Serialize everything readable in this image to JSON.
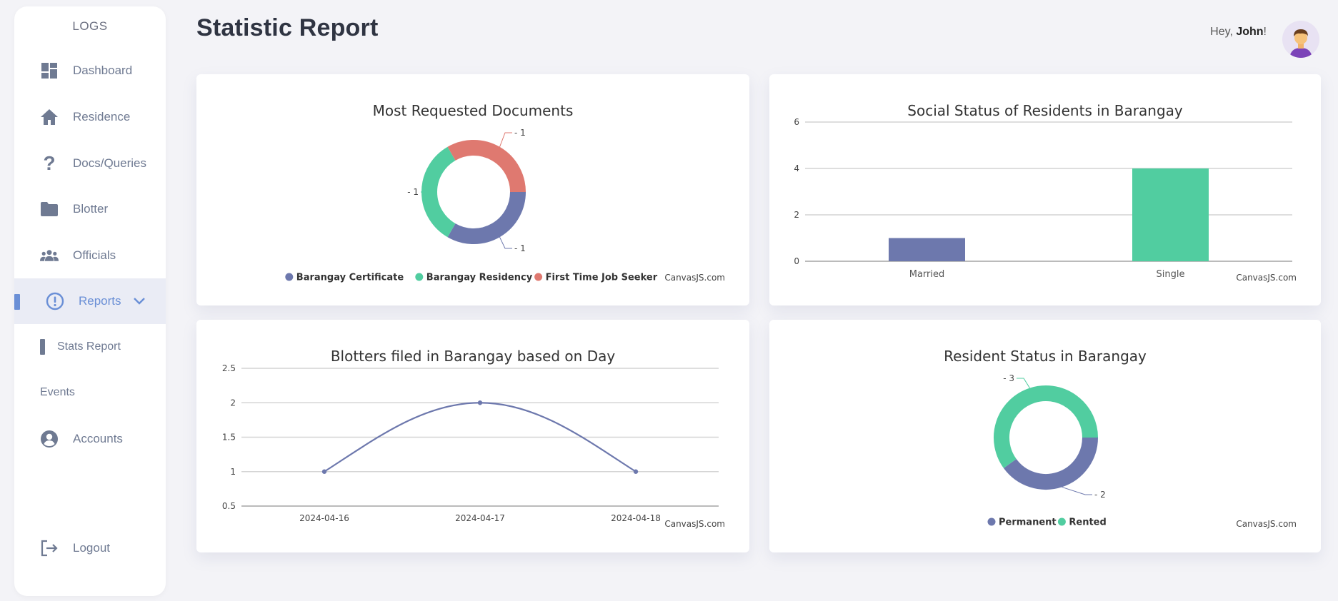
{
  "sidebar": {
    "logo": "LOGS",
    "items": [
      {
        "label": "Dashboard"
      },
      {
        "label": "Residence"
      },
      {
        "label": "Docs/Queries"
      },
      {
        "label": "Blotter"
      },
      {
        "label": "Officials"
      },
      {
        "label": "Reports"
      },
      {
        "label": "Stats Report"
      },
      {
        "label": "Events"
      },
      {
        "label": "Accounts"
      },
      {
        "label": "Logout"
      }
    ],
    "active_color": "#6a8fd6"
  },
  "header": {
    "title": "Statistic Report",
    "greeting_prefix": "Hey, ",
    "user_name": "John",
    "greeting_suffix": "!"
  },
  "colors": {
    "blue": "#6d78ad",
    "green": "#51cda0",
    "red": "#df7970"
  },
  "chart_data": [
    {
      "type": "pie",
      "title": "Most Requested Documents",
      "credit": "CanvasJS.com",
      "slices": [
        {
          "label": "Barangay Certificate",
          "value": 1,
          "color": "#6d78ad"
        },
        {
          "label": "Barangay Residency",
          "value": 1,
          "color": "#51cda0"
        },
        {
          "label": "First Time Job Seeker",
          "value": 1,
          "color": "#df7970"
        }
      ],
      "legend": "bottom"
    },
    {
      "type": "bar",
      "title": "Social Status of Residents in Barangay",
      "credit": "CanvasJS.com",
      "categories": [
        "Married",
        "Single"
      ],
      "values": [
        1,
        4
      ],
      "colors": [
        "#6d78ad",
        "#51cda0"
      ],
      "ylim": [
        0,
        6
      ],
      "yticks": [
        "0",
        "2",
        "4",
        "6"
      ],
      "grid": true
    },
    {
      "type": "line",
      "title": "Blotters filed in Barangay based on Day",
      "credit": "CanvasJS.com",
      "x": [
        "2024-04-16",
        "2024-04-17",
        "2024-04-18"
      ],
      "y": [
        1,
        2,
        1
      ],
      "color": "#6d78ad",
      "ylim": [
        0.5,
        2.5
      ],
      "yticks": [
        "0.5",
        "1",
        "1.5",
        "2",
        "2.5"
      ],
      "grid": true
    },
    {
      "type": "pie",
      "title": "Resident Status in Barangay",
      "credit": "CanvasJS.com",
      "slices": [
        {
          "label": "Permanent",
          "value": 2,
          "color": "#6d78ad"
        },
        {
          "label": "Rented",
          "value": 3,
          "color": "#51cda0"
        }
      ],
      "legend": "bottom"
    }
  ]
}
